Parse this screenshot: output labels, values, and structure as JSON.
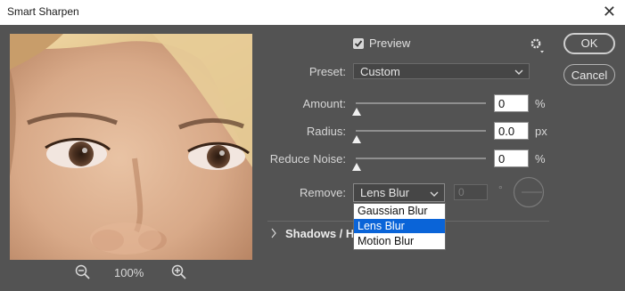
{
  "window": {
    "title": "Smart Sharpen"
  },
  "preview": {
    "checkbox_label": "Preview",
    "checked": true,
    "zoom_percent": "100%"
  },
  "buttons": {
    "ok": "OK",
    "cancel": "Cancel"
  },
  "preset": {
    "label": "Preset:",
    "value": "Custom"
  },
  "amount": {
    "label": "Amount:",
    "value": "0",
    "unit": "%",
    "slider_fraction": 0
  },
  "radius": {
    "label": "Radius:",
    "value": "0.0",
    "unit": "px",
    "slider_fraction": 0
  },
  "reduce_noise": {
    "label": "Reduce Noise:",
    "value": "0",
    "unit": "%",
    "slider_fraction": 0
  },
  "remove": {
    "label": "Remove:",
    "value": "Lens Blur",
    "angle_value": "0",
    "angle_unit": "°",
    "options": [
      {
        "label": "Gaussian Blur",
        "selected": false
      },
      {
        "label": "Lens Blur",
        "selected": true
      },
      {
        "label": "Motion Blur",
        "selected": false
      }
    ]
  },
  "shadows_section": {
    "label": "Shadows / H",
    "expanded": false
  },
  "colors": {
    "dialog_bg": "#535353",
    "highlight": "#0a64d8",
    "title_bg": "#ffffff"
  }
}
